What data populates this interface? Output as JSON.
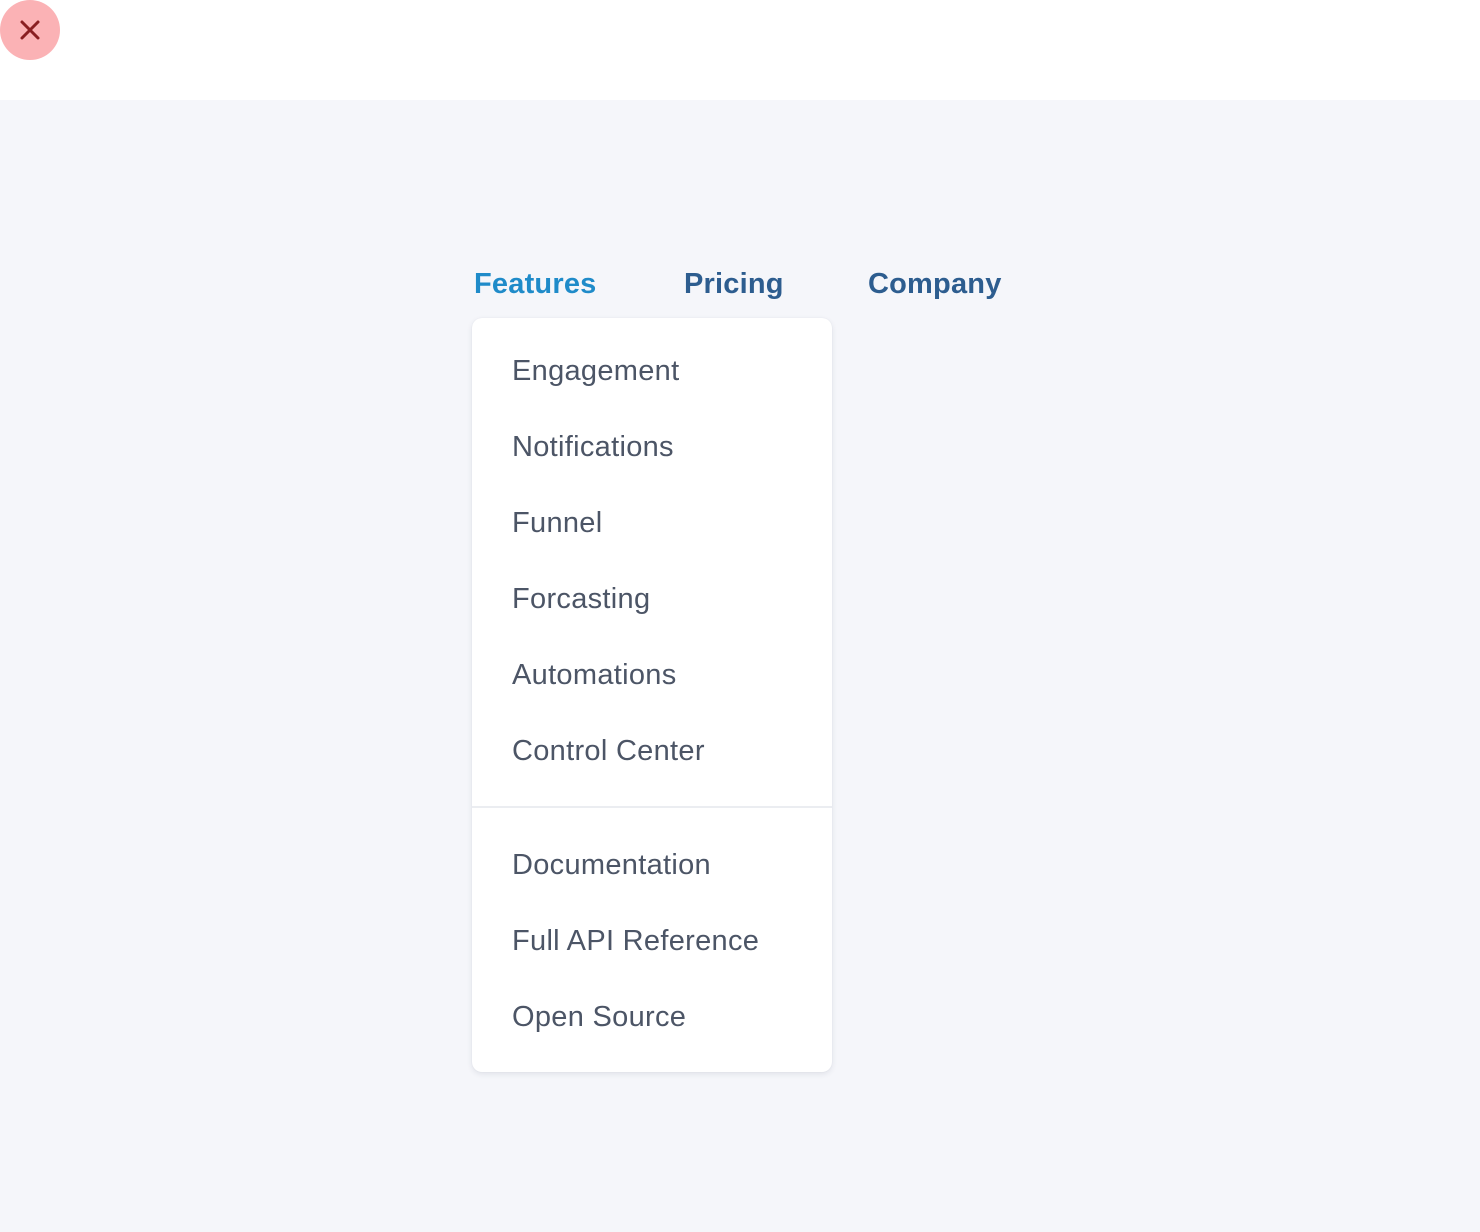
{
  "close": {
    "icon": "close-icon",
    "color": "#fbb2b5"
  },
  "nav": {
    "items": [
      {
        "label": "Features",
        "active": true
      },
      {
        "label": "Pricing",
        "active": false
      },
      {
        "label": "Company",
        "active": false
      }
    ]
  },
  "dropdown": {
    "primary_items": [
      {
        "label": "Engagement"
      },
      {
        "label": "Notifications"
      },
      {
        "label": "Funnel"
      },
      {
        "label": "Forcasting"
      },
      {
        "label": "Automations"
      },
      {
        "label": "Control Center"
      }
    ],
    "secondary_items": [
      {
        "label": "Documentation"
      },
      {
        "label": "Full API Reference"
      },
      {
        "label": "Open Source"
      }
    ]
  },
  "colors": {
    "active_nav": "#1f8bc9",
    "nav": "#2d5d8f",
    "menu_text": "#4c5566",
    "background": "#f5f6fa"
  }
}
